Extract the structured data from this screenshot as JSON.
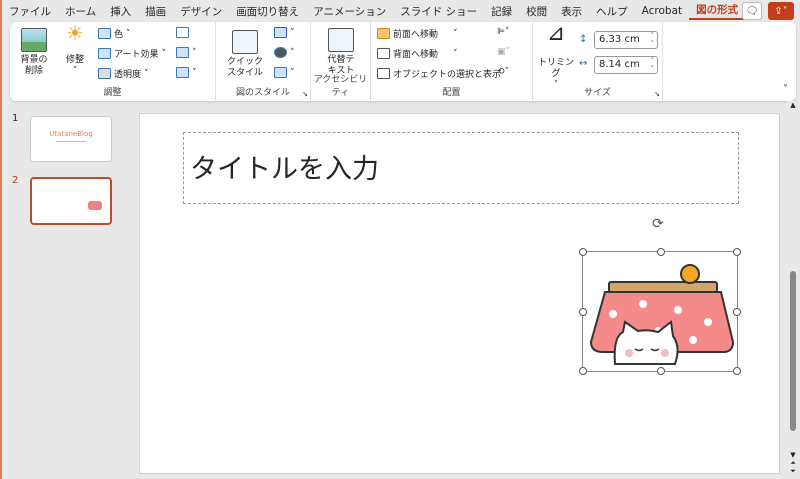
{
  "menu": {
    "tabs": [
      "ファイル",
      "ホーム",
      "挿入",
      "描画",
      "デザイン",
      "画面切り替え",
      "アニメーション",
      "スライド ショー",
      "記録",
      "校閲",
      "表示",
      "ヘルプ",
      "Acrobat",
      "図の形式"
    ],
    "active": "図の形式"
  },
  "ribbon": {
    "adjust": {
      "remove_bg": "背景の\n削除",
      "corrections": "修整",
      "color": "色",
      "artistic": "アート効果",
      "transparency": "透明度",
      "label": "調整"
    },
    "styles": {
      "quick": "クイック\nスタイル",
      "label": "図のスタイル"
    },
    "accessibility": {
      "alt_text": "代替テ\nキスト",
      "label": "アクセシビリティ"
    },
    "arrange": {
      "forward": "前面へ移動",
      "backward": "背面へ移動",
      "selection": "オブジェクトの選択と表示",
      "label": "配置"
    },
    "size": {
      "crop": "トリミング",
      "height": "6.33 cm",
      "width": "8.14 cm",
      "label": "サイズ"
    }
  },
  "thumbnails": [
    {
      "number": "1",
      "title": "UtataneBlog"
    },
    {
      "number": "2"
    }
  ],
  "slide": {
    "title_placeholder": "タイトルを入力"
  },
  "colors": {
    "accent": "#c43e1c"
  }
}
